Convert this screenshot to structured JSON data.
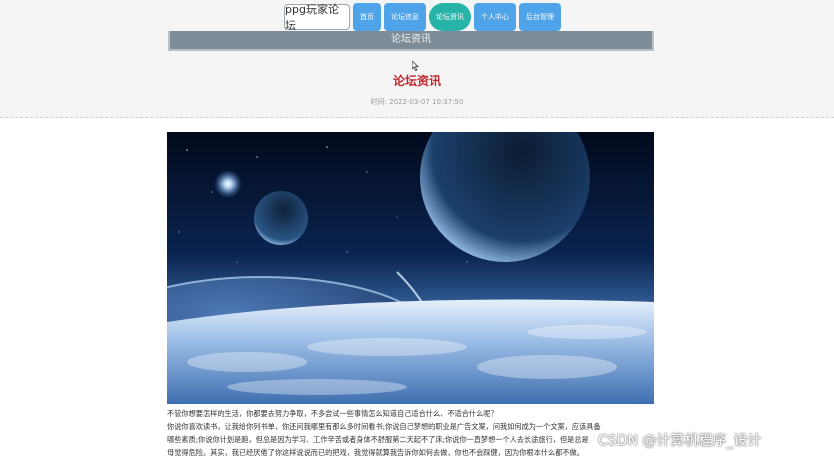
{
  "nav": {
    "logo": "ppg玩家论坛",
    "items": [
      {
        "label": "首页",
        "active": false
      },
      {
        "label": "论坛信息",
        "active": false
      },
      {
        "label": "论坛资讯",
        "active": true
      },
      {
        "label": "个人中心",
        "active": false
      },
      {
        "label": "后台管理",
        "active": false
      }
    ]
  },
  "banner": {
    "title": "论坛资讯"
  },
  "article": {
    "title": "论坛资讯",
    "time_label": "时间: 2022-03-07 10:37:50",
    "paragraphs": [
      "不管你想要怎样的生活，你都要去努力争取，不多尝试一些事情怎么知道自己适合什么、不适合什么呢？",
      "你说你喜欢读书，让我给你列书单，你还问我哪里有那么多时间看书;你说自己梦想的职业是广告文案，问我如何成为一个文案，应该具备",
      "哪些素质;你说你计划是跑，但总是因为学习、工作辛苦或者身体不舒服第二天起不了床;你说你一直梦想一个人去长途旅行，但是总是",
      "母觉得危险。其实，我已经厌倦了你这样说说而已的把戏，我觉得就算我告诉你如何去做，你也不会踩健，因为你根本什么都不做。"
    ]
  },
  "watermark": "CSDN @计算机程序_设计",
  "colors": {
    "nav_button": "#4fa3e8",
    "nav_active": "#27b3a7",
    "banner": "#7d8c96",
    "title_red": "#c0282d"
  }
}
